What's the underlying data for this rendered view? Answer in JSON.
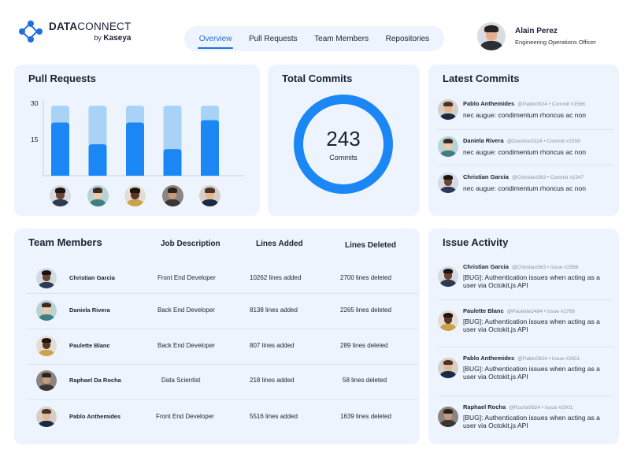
{
  "brand": {
    "name_bold": "DATA",
    "name_light": "CONNECT",
    "by_label": "by",
    "by_brand": "Kaseya",
    "accent": "#1f6fe0"
  },
  "nav": {
    "items": [
      {
        "label": "Overview",
        "active": true
      },
      {
        "label": "Pull Requests",
        "active": false
      },
      {
        "label": "Team Members",
        "active": false
      },
      {
        "label": "Repositories",
        "active": false
      }
    ]
  },
  "user": {
    "name": "Alain Perez",
    "role": "Engineering Operations Officer"
  },
  "pull_requests": {
    "title": "Pull Requests",
    "colors": {
      "total": "#a8d3f7",
      "merged": "#1a87f5"
    }
  },
  "chart_data": {
    "type": "bar",
    "title": "Pull Requests",
    "xlabel": "",
    "ylabel": "",
    "ylim": [
      0,
      30
    ],
    "yticks": [
      15,
      30
    ],
    "categories": [
      "Christian Garcia",
      "Daniela Rivera",
      "Paulette Blanc",
      "Raphael Da Rocha",
      "Pablo Anthemides"
    ],
    "series": [
      {
        "values": [
          29,
          29,
          29,
          29,
          29
        ],
        "color": "#a8d3f7"
      },
      {
        "values": [
          22,
          13,
          22,
          11,
          23
        ],
        "color": "#1a87f5"
      }
    ],
    "grid": false,
    "stacked": "overlay"
  },
  "total_commits": {
    "title": "Total Commits",
    "value": "243",
    "label": "Commits",
    "color": "#1a87f5"
  },
  "latest_commits": {
    "title": "Latest Commits",
    "items": [
      {
        "name": "Pablo Anthemides",
        "meta": "@Pablo0924 • Commit #1566",
        "message": "nec augue: condimentum rhoncus ac non"
      },
      {
        "name": "Daniela Rivera",
        "meta": "@Danirive3324 • Commit #1559",
        "message": "nec augue: condimentum rhoncus ac non"
      },
      {
        "name": "Christian Garcia",
        "meta": "@Christian563 • Commit #1547",
        "message": "nec augue: condimentum rhoncus ac non"
      }
    ]
  },
  "team": {
    "title": "Team Members",
    "columns": [
      "Job Description",
      "Lines Added",
      "Lines Deleted"
    ],
    "rows": [
      {
        "name": "Christian Garcia",
        "job": "Front End Developer",
        "added": "10262 lines added",
        "deleted": "2700 lines deleted"
      },
      {
        "name": "Daniela Rivera",
        "job": "Back End Developer",
        "added": "8138 lines added",
        "deleted": "2265 lines deleted"
      },
      {
        "name": "Paulette Blanc",
        "job": "Back End Developer",
        "added": "807 lines added",
        "deleted": "289 lines deleted"
      },
      {
        "name": "Raphael Da Rocha",
        "job": "Data Scientist",
        "added": "218 lines added",
        "deleted": "58 lines deleted"
      },
      {
        "name": "Pablo Anthemides",
        "job": "Front End Developer",
        "added": "5516 lines added",
        "deleted": "1639 lines deleted"
      }
    ]
  },
  "issues": {
    "title": "Issue Activity",
    "items": [
      {
        "name": "Christian Garcia",
        "meta": "@Christian563 • Issue #2568",
        "message": "[BUG]: Authentication issues when acting as a user via Octokit.js API"
      },
      {
        "name": "Paulette Blanc",
        "meta": "@Paulette2484 • Issue #2768",
        "message": "[BUG]: Authentication issues when acting as a user via Octokit.js API"
      },
      {
        "name": "Pablo Anthemides",
        "meta": "@Pablo0924 • Issue #2801",
        "message": "[BUG]: Authentication issues when acting as a user via Octokit.js API"
      },
      {
        "name": "Raphael  Rocha",
        "meta": "@Rocha0924 • Issue #2001",
        "message": "[BUG]: Authentication issues when acting as a user via Octokit.js API"
      }
    ]
  }
}
